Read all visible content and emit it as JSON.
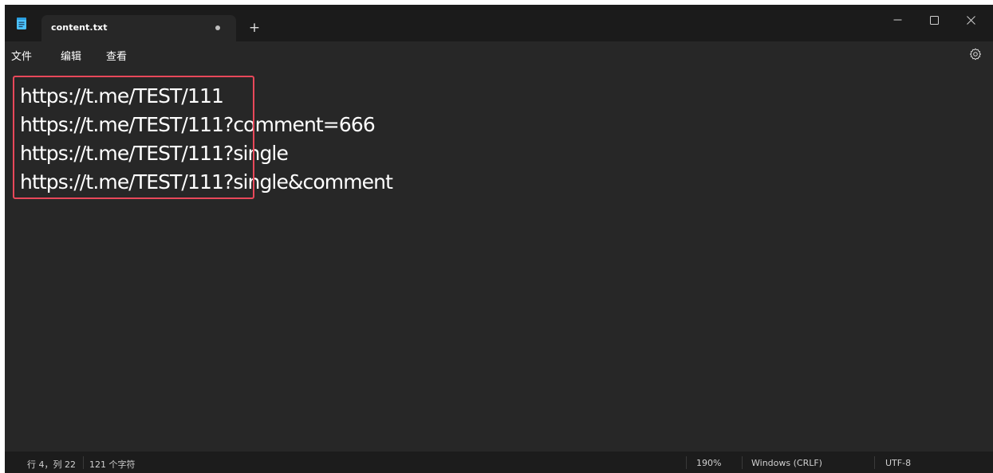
{
  "tab": {
    "title": "content.txt",
    "unsaved_dot": "•",
    "add_label": "+"
  },
  "window_controls": {
    "minimize": "—",
    "maximize": "☐",
    "close": "✕"
  },
  "menu": {
    "file": "文件",
    "edit": "编辑",
    "view": "查看"
  },
  "editor": {
    "lines": [
      "https://t.me/TEST/111",
      "https://t.me/TEST/111?comment=666",
      "https://t.me/TEST/111?single",
      "https://t.me/TEST/111?single&comment"
    ]
  },
  "status": {
    "position": "行 4，列 22",
    "char_count": "121 个字符",
    "zoom": "190%",
    "line_ending": "Windows (CRLF)",
    "encoding": "UTF-8"
  },
  "colors": {
    "highlight_border": "#e8485a",
    "editor_bg": "#272727",
    "titlebar_bg": "#1b1b1b",
    "app_icon": "#4cc2ff"
  }
}
